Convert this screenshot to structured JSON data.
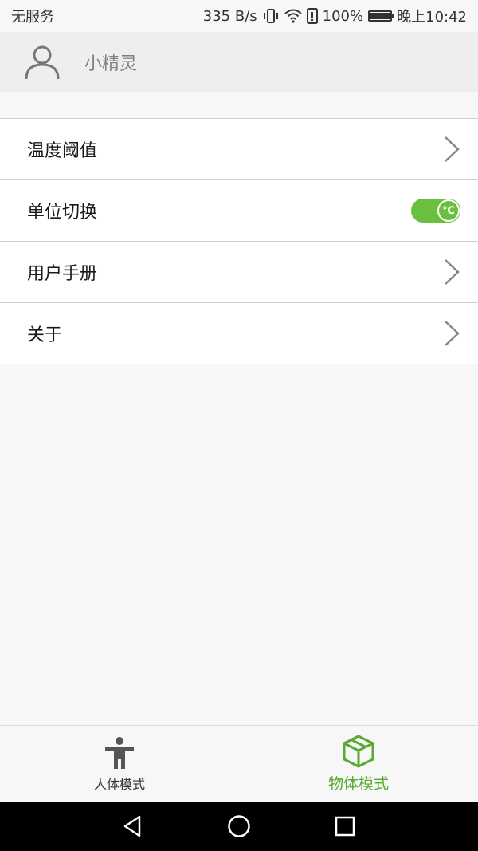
{
  "status_bar": {
    "carrier": "无服务",
    "speed": "335 B/s",
    "battery": "100%",
    "time": "晚上10:42"
  },
  "header": {
    "title": "小精灵",
    "icon": "user-icon"
  },
  "settings": {
    "items": [
      {
        "label": "温度阈值",
        "control": "chevron"
      },
      {
        "label": "单位切换",
        "control": "toggle",
        "toggle_text": "℃",
        "on": true
      },
      {
        "label": "用户手册",
        "control": "chevron"
      },
      {
        "label": "关于",
        "control": "chevron"
      }
    ]
  },
  "tabs": [
    {
      "label": "人体模式",
      "icon": "person-icon",
      "active": false
    },
    {
      "label": "物体模式",
      "icon": "box-icon",
      "active": true
    }
  ],
  "colors": {
    "accent": "#5aaa31",
    "toggle": "#6abf3e",
    "background": "#f7f7f7"
  }
}
